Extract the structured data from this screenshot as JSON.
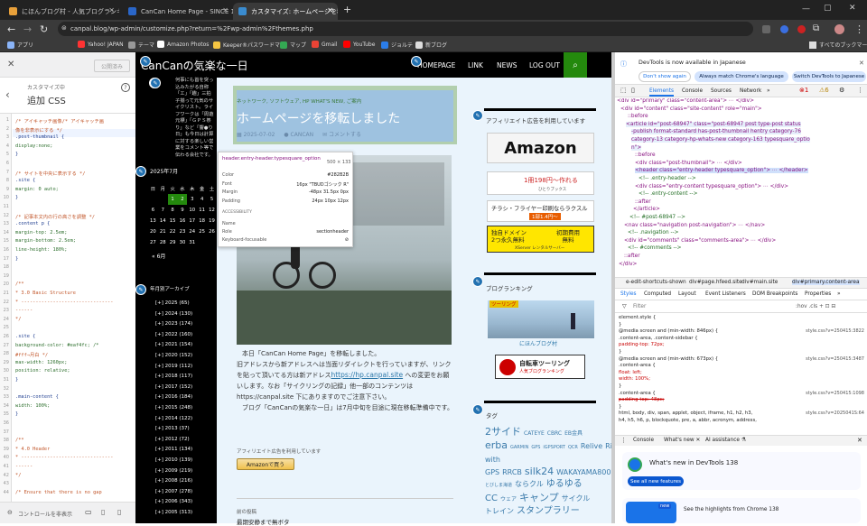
{
  "browser": {
    "tabs": [
      {
        "title": "にほんブログ村 - 人気ブログランキ…",
        "fav": "#e8a03a"
      },
      {
        "title": "CanCan Home Page - SINCE 19…",
        "fav": "#2a66c8"
      },
      {
        "title": "カスタマイズ: ホームページを移転しま…",
        "fav": "#3a8cd0"
      }
    ],
    "new_tab": "+",
    "url": "canpal.blog/wp-admin/customize.php?return=%2Fwp-admin%2Fthemes.php",
    "bookmarks": [
      "アプリ",
      "Yahoo! JAPAN",
      "テーマ",
      "Amazon Photos",
      "Keeper®パスワードマ…",
      "マップ",
      "Gmail",
      "YouTube",
      "ジョルテ",
      "新ブログ"
    ],
    "all_bookmarks": "すべてのブックマーク"
  },
  "customizer": {
    "close": "✕",
    "publish": "公開済み",
    "breadcrumb": "カスタマイズ中",
    "section_title": "追加 CSS",
    "help": "?",
    "code_lines": [
      "/* アイキャッチ画像/* アイキャッチ画",
      "像を非表示にする */",
      ".post-thumbnail {",
      "    display:none;",
      "}",
      "",
      "/*  サイトを中央に表示する  */",
      ".site {",
      "    margin: 0 auto;",
      "}",
      "",
      "/* 記事本文内の行の高さを調整 */",
      ".content p {",
      "    margin-top: 2.5em;",
      "    margin-bottom: 2.5em;",
      "    line-height: 180%;",
      "}",
      "",
      "",
      "/**",
      " * 3.0 Basic Structure",
      " * --------------------------------",
      "------",
      " */",
      "",
      ".site {",
      "    background-color: #eaf4fc; /*",
      "#fff→月白 */",
      "    max-width: 1260px;",
      "    position: relative;",
      "}",
      "",
      ".main-content {",
      "    width: 100%;",
      "}",
      "",
      "",
      "/**",
      " * 4.0 Header",
      " * --------------------------------",
      "------",
      " */",
      "",
      "/* Ensure that there is no gap"
    ],
    "footer_label": "コントロールを非表示"
  },
  "site": {
    "title": "CanCanの気楽な一日",
    "nav": [
      "HOMEPAGE",
      "LINK",
      "NEWS",
      "LOG OUT"
    ],
    "sidebar_intro": "何事にも首を突っ込みたがる自称「エ」「趣」三拍子揃って元気のサイクリスト。ライフワークは「周遊元標」「ＧＰＳ祭り」など「響●り日」も今日は計算に対する楽しい営業をコメント等で伝わる会社です。",
    "calendar_title": "2025年7月",
    "calendar_head": [
      "日",
      "月",
      "火",
      "水",
      "木",
      "金",
      "土"
    ],
    "calendar_rows": [
      [
        "",
        "",
        "1",
        "2",
        "3",
        "4",
        "5"
      ],
      [
        "6",
        "7",
        "8",
        "9",
        "10",
        "11",
        "12"
      ],
      [
        "13",
        "14",
        "15",
        "16",
        "17",
        "18",
        "19"
      ],
      [
        "20",
        "21",
        "22",
        "23",
        "24",
        "25",
        "26"
      ],
      [
        "27",
        "28",
        "29",
        "30",
        "31",
        "",
        ""
      ]
    ],
    "calendar_prev": "« 6月",
    "archive_title": "年月別アーカイブ",
    "archives": [
      "2025 (65)",
      "2024 (130)",
      "2023 (174)",
      "2022 (160)",
      "2021 (154)",
      "2020 (152)",
      "2019 (112)",
      "2018 (117)",
      "2017 (152)",
      "2016 (184)",
      "2015 (248)",
      "2014 (122)",
      "2013 (37)",
      "2012 (72)",
      "2011 (134)",
      "2010 (139)",
      "2009 (219)",
      "2008 (216)",
      "2007 (278)",
      "2006 (343)",
      "2005 (313)"
    ],
    "post_cats": "ネットワーク, ソフトウェア, HP WHAT'S NEW, ご案内",
    "post_title": "ホームページを移転しました",
    "post_date": "2025-07-02",
    "post_author": "CANCAN",
    "post_comment": "コメントする",
    "post_para1": "本日「CanCan Home Page」を移転しました。",
    "post_para2": "旧アドレスから新アドレスへは当面リダイレクトを行っていますが、リンクを貼って頂いてる方は新アドレス",
    "post_link": "https://hp.canpal.site",
    "post_para3": " への変更をお願いします。なお「サイクリングの記録」他一部のコンテンツは https://canpal.site 下にありますのでご注意下さい。",
    "post_para4": "ブログ「CanCanの気楽な一日」は7月中旬を目途に現在移転準備中です。",
    "affiliate_small": "アフィリエイト広告を利用しています",
    "amazon_btn": "Amazonで買う",
    "prev_label": "前の投稿",
    "prev_title": "最期安静まで無ボタ",
    "right_affiliate": "アフィリエイト広告を利用しています",
    "amazon_logo": "Amazon",
    "ad1_line": "1冊198円〜作れる",
    "ad1_sub": "ひとりブックス",
    "ad2_line": "チラシ・フライヤー印刷ならラクスル",
    "ad2_price": "1部1.4円〜",
    "ad3_left": "独自ドメイン\n2つ永久無料",
    "ad3_right": "初期費用\n無料",
    "ad3_brand": "XServer レンタルサーバー",
    "ranking_title": "ブログランキング",
    "ranking_badge": "ツーリング",
    "ranking_caption": "にほんブログ村",
    "ranking2_line1": "自転車ツーリング",
    "ranking2_line2": "人気ブログランキング",
    "tag_title": "タグ",
    "tags": [
      {
        "t": "2サイド",
        "s": 11
      },
      {
        "t": "CATEYE",
        "s": 6
      },
      {
        "t": "CBRC",
        "s": 6
      },
      {
        "t": "EB金具",
        "s": 6
      },
      {
        "t": "erba",
        "s": 11
      },
      {
        "t": "GARMIN",
        "s": 5
      },
      {
        "t": "GPS",
        "s": 5
      },
      {
        "t": "iGPSPORT",
        "s": 5
      },
      {
        "t": "QCR",
        "s": 5
      },
      {
        "t": "Relive",
        "s": 8
      },
      {
        "t": "Ride with GPS",
        "s": 8
      },
      {
        "t": "RRCB",
        "s": 8
      },
      {
        "t": "silk24",
        "s": 11
      },
      {
        "t": "WAKAYAMA800",
        "s": 8
      },
      {
        "t": "とびしま海道",
        "s": 5
      },
      {
        "t": "ならクル",
        "s": 8
      },
      {
        "t": "ゆるゆるCC",
        "s": 10
      },
      {
        "t": "ウェア",
        "s": 6
      },
      {
        "t": "キャンプ",
        "s": 11
      },
      {
        "t": "サイクルトレイン",
        "s": 8
      },
      {
        "t": "スタンプラリー",
        "s": 10
      }
    ]
  },
  "tooltip": {
    "selector": "header.entry-header.typesquare_option",
    "dims": "500 × 133",
    "rows": [
      {
        "k": "Color",
        "v": "#282B2B"
      },
      {
        "k": "Font",
        "v": "16px \"TBUDゴシック R\""
      },
      {
        "k": "Margin",
        "v": "-48px 31.5px 0px"
      },
      {
        "k": "Padding",
        "v": "24px 10px 12px"
      }
    ],
    "accessibility": "ACCESSIBILITY",
    "acc_rows": [
      {
        "k": "Name",
        "v": ""
      },
      {
        "k": "Role",
        "v": "sectionheader"
      },
      {
        "k": "Keyboard-focusable",
        "v": "⊘"
      }
    ]
  },
  "devtools": {
    "banner": "DevTools is now available in Japanese",
    "dont_ask": "Don't show again",
    "always_match": "Always match Chrome's language",
    "switch": "Switch DevTools to Japanese",
    "tabs": [
      "Elements",
      "Console",
      "Sources",
      "Network",
      "»"
    ],
    "dom_lines": [
      "<div id=\"primary\" class=\"content-area\"> ⋯ </div>",
      "<div id=\"content\" class=\"site-content\" role=\"main\">",
      "::before",
      "<article id=\"post-68947\" class=\"post-68947 post type-post status",
      "-publish format-standard has-post-thumbnail hentry category-76",
      "category-13 category-hp-whats-new category-163 typesquare_optio",
      "n\">",
      "::before",
      "<div class=\"post-thumbnail\"> ⋯ </div>",
      "<header class=\"entry-header typesquare_option\"> ⋯ </header>",
      "<!-- .entry-header -->",
      "<div class=\"entry-content typesquare_option\"> ⋯ </div>",
      "<!-- .entry-content -->",
      "::after",
      "</article>",
      "<!-- #post-68947 -->",
      "<nav class=\"navigation post-navigation\"> ⋯ </nav>",
      "<!-- .navigation -->",
      "<div id=\"comments\" class=\"comments-area\"> ⋯ </div>",
      "<!-- #comments -->",
      "::after",
      "</div>"
    ],
    "crumbs": [
      "e-edit-shortcuts-shown",
      "div#page.hfeed.site",
      "div#main.site",
      "div#primary.content-area"
    ],
    "style_tabs": [
      "Styles",
      "Computed",
      "Layout",
      "Event Listeners",
      "DOM Breakpoints",
      "Properties",
      "»"
    ],
    "filter": "Filter",
    "filter_right": ":hov .cls + ⊡ ⊟",
    "style_rules": [
      {
        "sel": "element.style {",
        "src": ""
      },
      {
        "sel": "}",
        "src": ""
      },
      {
        "sel": "@media screen and (min-width: 846px) {",
        "src": "style.css?v=250415:3822"
      },
      {
        "sel": ".content-area, .content-sidebar {",
        "src": ""
      },
      {
        "sel": "  padding-top: 72px;",
        "src": ""
      },
      {
        "sel": "}",
        "src": ""
      },
      {
        "sel": "@media screen and (min-width: 673px) {",
        "src": "style.css?v=250415:3487"
      },
      {
        "sel": ".content-area {",
        "src": ""
      },
      {
        "sel": "  float: left;",
        "src": ""
      },
      {
        "sel": "  width: 100%;",
        "src": ""
      },
      {
        "sel": "}",
        "src": ""
      },
      {
        "sel": ".content-area {",
        "src": "style.css?v=250415:1098"
      },
      {
        "sel": "  padding-top: 48px;",
        "src": ""
      },
      {
        "sel": "}",
        "src": ""
      },
      {
        "sel": "html, body, div, span, applet, object, iframe, h1, h2, h3,",
        "src": "style.css?v=2025041S:64"
      },
      {
        "sel": "h4, h5, h6, p, blockquote, pre, a, abbr, acronym, address,",
        "src": ""
      }
    ],
    "drawer_tabs": [
      "Console",
      "What's new ✕",
      "AI assistance ⚗"
    ],
    "whatsnew_title": "What's new in DevTools 138",
    "see_features": "See all new features",
    "highlight": "See the highlights from Chrome 138",
    "new_badge": "new"
  }
}
